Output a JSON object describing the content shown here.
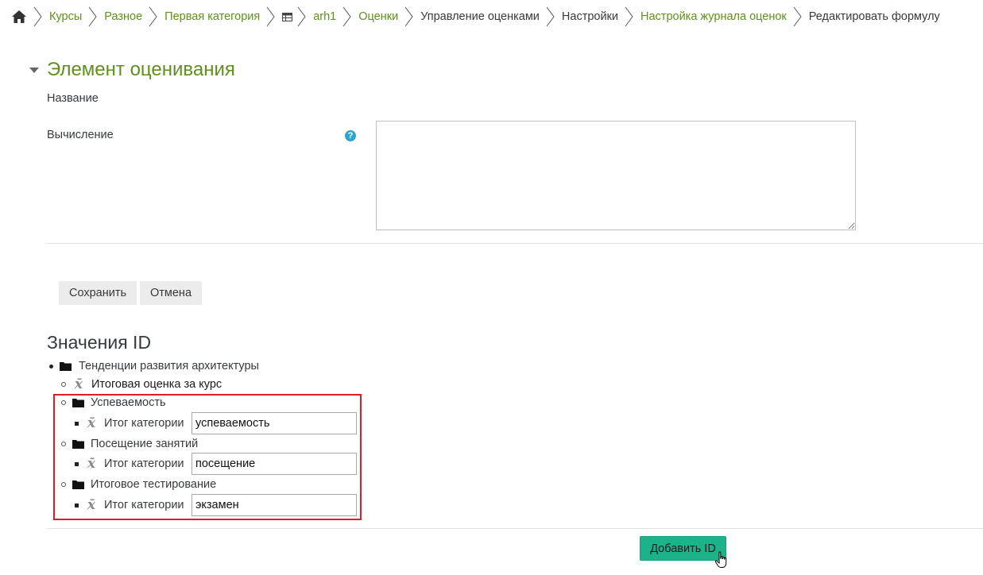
{
  "breadcrumb": {
    "items": [
      "Курсы",
      "Разное",
      "Первая категория",
      "arh1",
      "Оценки",
      "Управление оценками",
      "Настройки",
      "Настройка журнала оценок",
      "Редактировать формулу"
    ]
  },
  "section": {
    "title": "Элемент оценивания",
    "name_label": "Название",
    "calc_label": "Вычисление",
    "calc_value": ""
  },
  "buttons": {
    "save": "Сохранить",
    "cancel": "Отмена",
    "add_id": "Добавить ID"
  },
  "ids": {
    "title": "Значения ID",
    "root": "Тенденции развития архитектуры",
    "course_total": "Итоговая оценка за курс",
    "categories": [
      {
        "name": "Успеваемость",
        "item_label": "Итог категории",
        "id_value": "успеваемость"
      },
      {
        "name": "Посещение занятий",
        "item_label": "Итог категории",
        "id_value": "посещение"
      },
      {
        "name": "Итоговое тестирование",
        "item_label": "Итог категории",
        "id_value": "экзамен"
      }
    ]
  },
  "colors": {
    "link": "#5f8f1f",
    "primary": "#1db28a",
    "highlight": "#e31b23",
    "help": "#2fa4d0"
  }
}
